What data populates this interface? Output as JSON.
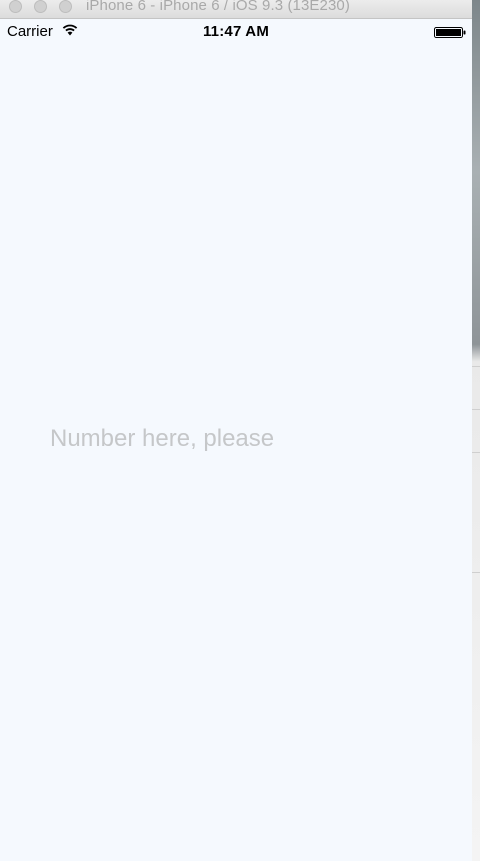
{
  "window": {
    "title": "iPhone 6 - iPhone 6 / iOS 9.3 (13E230)"
  },
  "status_bar": {
    "carrier": "Carrier",
    "time": "11:47 AM",
    "wifi_icon": "wifi-icon",
    "battery_icon": "battery-icon"
  },
  "main": {
    "number_input": {
      "value": "",
      "placeholder": "Number here, please"
    }
  },
  "colors": {
    "screen_background": "#f5f9fe",
    "placeholder_text": "#c5c7c9"
  }
}
